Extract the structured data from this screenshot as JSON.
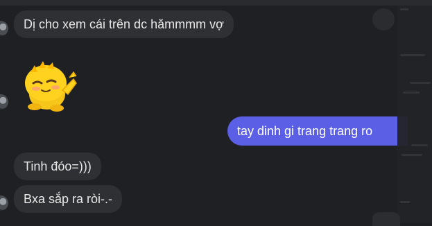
{
  "conversation": {
    "messages": [
      {
        "sender": "other",
        "text": "Dị cho xem cái trên dc hămmmm vợ"
      },
      {
        "sender": "other",
        "type": "sticker",
        "sticker_name": "yellow-chick-wink-sticker"
      },
      {
        "sender": "me",
        "text": "tay dinh gi trang trang ro"
      },
      {
        "sender": "other",
        "text": "Tinh đóo=)))"
      },
      {
        "sender": "other",
        "text": "Bxa sắp ra ròi-.-"
      }
    ]
  },
  "colors": {
    "background": "#1f2023",
    "incoming_bubble": "#2f3033",
    "outgoing_bubble": "#5b5fe6",
    "text": "#e8e8e8"
  }
}
